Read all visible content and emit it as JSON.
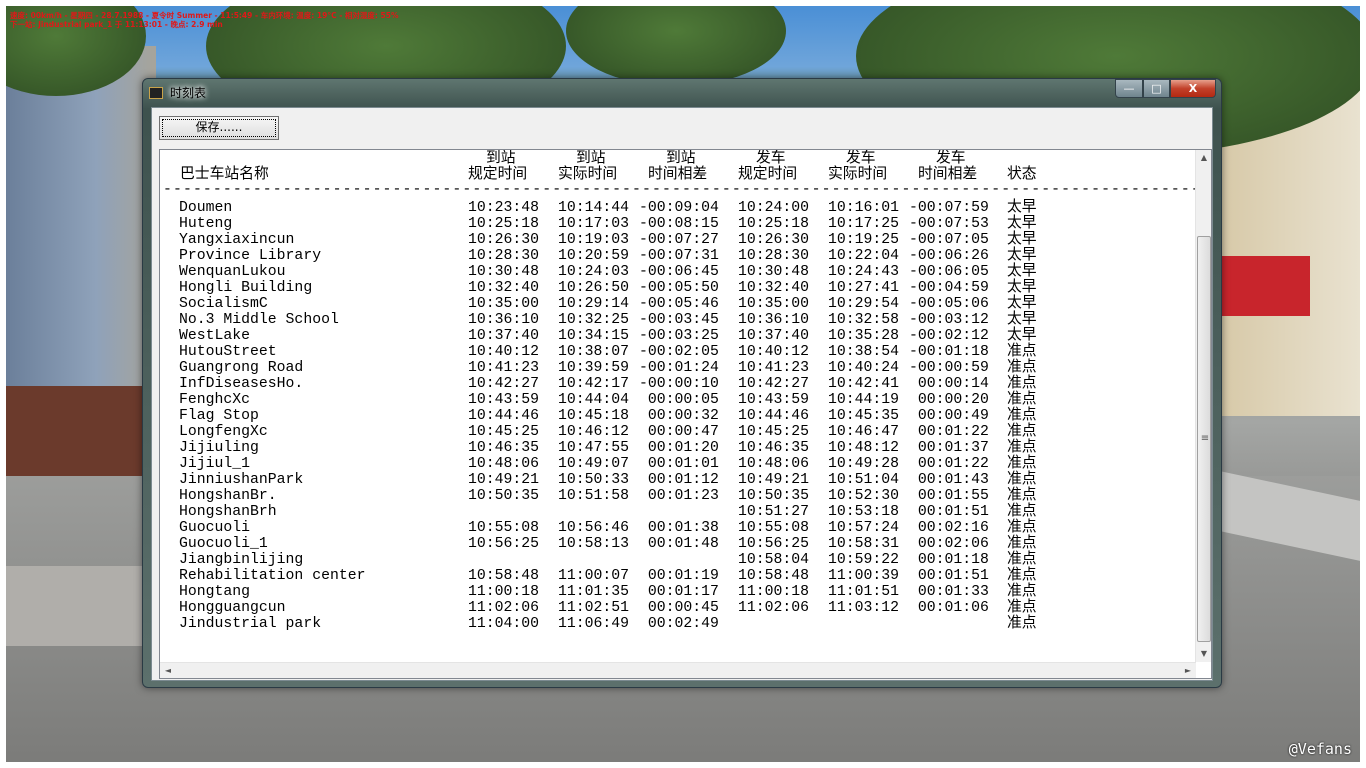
{
  "hud": {
    "line1": "速度: 00km/h - 星期四 - 28.7.1988 - 夏令时 Summer - 11:5:49 - 车内环境: 温度: 19°C - 相对湿度: 55%",
    "line2": "下一站: Jindustrial park_1 于 11:13:01 - 晚点: 2.9 min"
  },
  "watermark": "@Vefans",
  "window": {
    "title": "时刻表",
    "min": "—",
    "max": "□",
    "close": "X"
  },
  "toolbar": {
    "save_label": "保存......"
  },
  "table": {
    "headers": {
      "name": "巴士车站名称",
      "arr_sched": [
        "到站",
        "规定时间"
      ],
      "arr_actual": [
        "到站",
        "实际时间"
      ],
      "arr_diff": [
        "到站",
        "时间相差"
      ],
      "dep_sched": [
        "发车",
        "规定时间"
      ],
      "dep_actual": [
        "发车",
        "实际时间"
      ],
      "dep_diff": [
        "发车",
        "时间相差"
      ],
      "status": "状态"
    },
    "separator": "---------------------------------------------------------------------------------------------------------------------",
    "rows": [
      [
        "Doumen",
        "10:23:48",
        "10:14:44",
        "-00:09:04",
        "10:24:00",
        "10:16:01",
        "-00:07:59",
        "太早"
      ],
      [
        "Huteng",
        "10:25:18",
        "10:17:03",
        "-00:08:15",
        "10:25:18",
        "10:17:25",
        "-00:07:53",
        "太早"
      ],
      [
        "Yangxiaxincun",
        "10:26:30",
        "10:19:03",
        "-00:07:27",
        "10:26:30",
        "10:19:25",
        "-00:07:05",
        "太早"
      ],
      [
        "Province Library",
        "10:28:30",
        "10:20:59",
        "-00:07:31",
        "10:28:30",
        "10:22:04",
        "-00:06:26",
        "太早"
      ],
      [
        "WenquanLukou",
        "10:30:48",
        "10:24:03",
        "-00:06:45",
        "10:30:48",
        "10:24:43",
        "-00:06:05",
        "太早"
      ],
      [
        "Hongli Building",
        "10:32:40",
        "10:26:50",
        "-00:05:50",
        "10:32:40",
        "10:27:41",
        "-00:04:59",
        "太早"
      ],
      [
        "SocialismC",
        "10:35:00",
        "10:29:14",
        "-00:05:46",
        "10:35:00",
        "10:29:54",
        "-00:05:06",
        "太早"
      ],
      [
        "No.3 Middle School",
        "10:36:10",
        "10:32:25",
        "-00:03:45",
        "10:36:10",
        "10:32:58",
        "-00:03:12",
        "太早"
      ],
      [
        "WestLake",
        "10:37:40",
        "10:34:15",
        "-00:03:25",
        "10:37:40",
        "10:35:28",
        "-00:02:12",
        "太早"
      ],
      [
        "HutouStreet",
        "10:40:12",
        "10:38:07",
        "-00:02:05",
        "10:40:12",
        "10:38:54",
        "-00:01:18",
        "准点"
      ],
      [
        "Guangrong Road",
        "10:41:23",
        "10:39:59",
        "-00:01:24",
        "10:41:23",
        "10:40:24",
        "-00:00:59",
        "准点"
      ],
      [
        "InfDiseasesHo.",
        "10:42:27",
        "10:42:17",
        "-00:00:10",
        "10:42:27",
        "10:42:41",
        " 00:00:14",
        "准点"
      ],
      [
        "FenghcXc",
        "10:43:59",
        "10:44:04",
        " 00:00:05",
        "10:43:59",
        "10:44:19",
        " 00:00:20",
        "准点"
      ],
      [
        "Flag Stop",
        "10:44:46",
        "10:45:18",
        " 00:00:32",
        "10:44:46",
        "10:45:35",
        " 00:00:49",
        "准点"
      ],
      [
        "LongfengXc",
        "10:45:25",
        "10:46:12",
        " 00:00:47",
        "10:45:25",
        "10:46:47",
        " 00:01:22",
        "准点"
      ],
      [
        "Jijiuling",
        "10:46:35",
        "10:47:55",
        " 00:01:20",
        "10:46:35",
        "10:48:12",
        " 00:01:37",
        "准点"
      ],
      [
        "Jijiul_1",
        "10:48:06",
        "10:49:07",
        " 00:01:01",
        "10:48:06",
        "10:49:28",
        " 00:01:22",
        "准点"
      ],
      [
        "JinniushanPark",
        "10:49:21",
        "10:50:33",
        " 00:01:12",
        "10:49:21",
        "10:51:04",
        " 00:01:43",
        "准点"
      ],
      [
        "HongshanBr.",
        "10:50:35",
        "10:51:58",
        " 00:01:23",
        "10:50:35",
        "10:52:30",
        " 00:01:55",
        "准点"
      ],
      [
        "HongshanBrh",
        "",
        "",
        "",
        "10:51:27",
        "10:53:18",
        " 00:01:51",
        "准点"
      ],
      [
        "Guocuoli",
        "10:55:08",
        "10:56:46",
        " 00:01:38",
        "10:55:08",
        "10:57:24",
        " 00:02:16",
        "准点"
      ],
      [
        "Guocuoli_1",
        "10:56:25",
        "10:58:13",
        " 00:01:48",
        "10:56:25",
        "10:58:31",
        " 00:02:06",
        "准点"
      ],
      [
        "Jiangbinlijing",
        "",
        "",
        "",
        "10:58:04",
        "10:59:22",
        " 00:01:18",
        "准点"
      ],
      [
        "Rehabilitation center",
        "10:58:48",
        "11:00:07",
        " 00:01:19",
        "10:58:48",
        "11:00:39",
        " 00:01:51",
        "准点"
      ],
      [
        "Hongtang",
        "11:00:18",
        "11:01:35",
        " 00:01:17",
        "11:00:18",
        "11:01:51",
        " 00:01:33",
        "准点"
      ],
      [
        "Hongguangcun",
        "11:02:06",
        "11:02:51",
        " 00:00:45",
        "11:02:06",
        "11:03:12",
        " 00:01:06",
        "准点"
      ],
      [
        "Jindustrial park",
        "11:04:00",
        "11:06:49",
        " 00:02:49",
        "",
        "",
        "",
        "准点"
      ]
    ]
  },
  "scrollbars": {
    "up": "▲",
    "down": "▼",
    "left": "◄",
    "right": "►",
    "grip": "≡"
  }
}
